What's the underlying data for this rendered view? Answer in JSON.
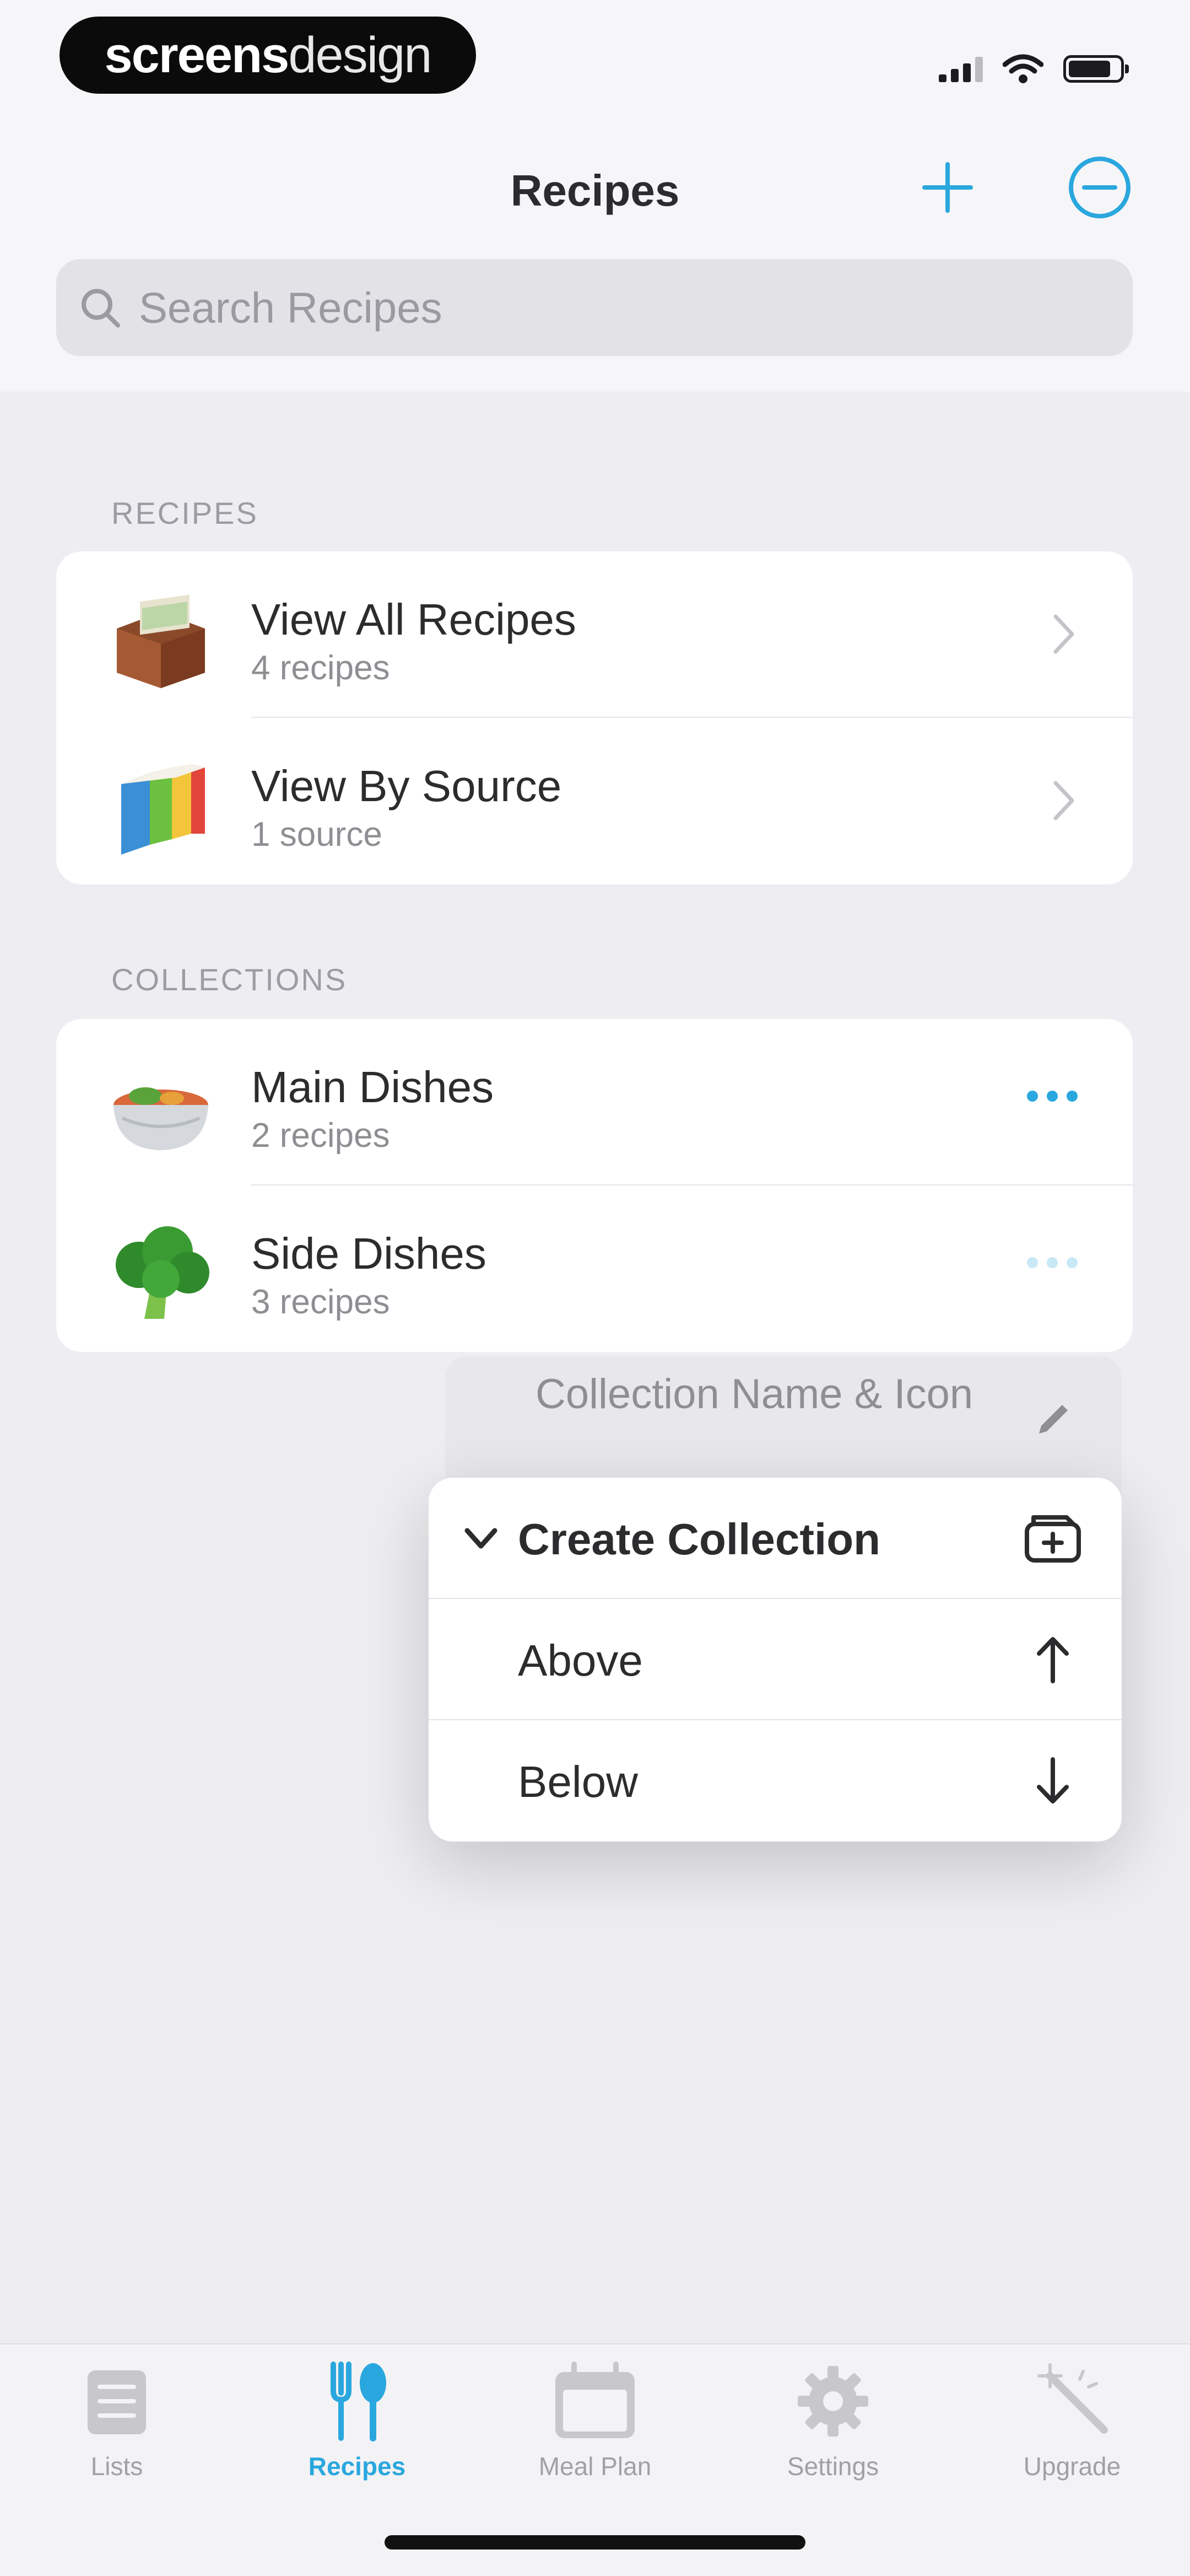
{
  "status_bar": {
    "brand_part1": "screens",
    "brand_part2": "design"
  },
  "nav": {
    "title": "Recipes",
    "add_icon": "plus-icon",
    "edit_icon": "minus-circle-icon"
  },
  "search": {
    "placeholder": "Search Recipes"
  },
  "sections": {
    "recipes_header": "RECIPES",
    "collections_header": "COLLECTIONS"
  },
  "recipes": [
    {
      "title": "View All Recipes",
      "subtitle": "4 recipes",
      "icon": "recipe-box-icon"
    },
    {
      "title": "View By Source",
      "subtitle": "1 source",
      "icon": "books-icon"
    }
  ],
  "collections": [
    {
      "title": "Main Dishes",
      "subtitle": "2 recipes",
      "icon": "curry-bowl-icon"
    },
    {
      "title": "Side Dishes",
      "subtitle": "3 recipes",
      "icon": "broccoli-icon"
    }
  ],
  "context_menu": {
    "peek_item": "Collection Name & Icon",
    "create_collection": "Create Collection",
    "above": "Above",
    "below": "Below"
  },
  "tabs": [
    {
      "label": "Lists",
      "icon": "list-icon"
    },
    {
      "label": "Recipes",
      "icon": "fork-spoon-icon"
    },
    {
      "label": "Meal Plan",
      "icon": "calendar-icon"
    },
    {
      "label": "Settings",
      "icon": "gear-icon"
    },
    {
      "label": "Upgrade",
      "icon": "magic-wand-icon"
    }
  ],
  "colors": {
    "accent": "#2aa7de",
    "background": "#eeeef2",
    "card": "#ffffff"
  }
}
